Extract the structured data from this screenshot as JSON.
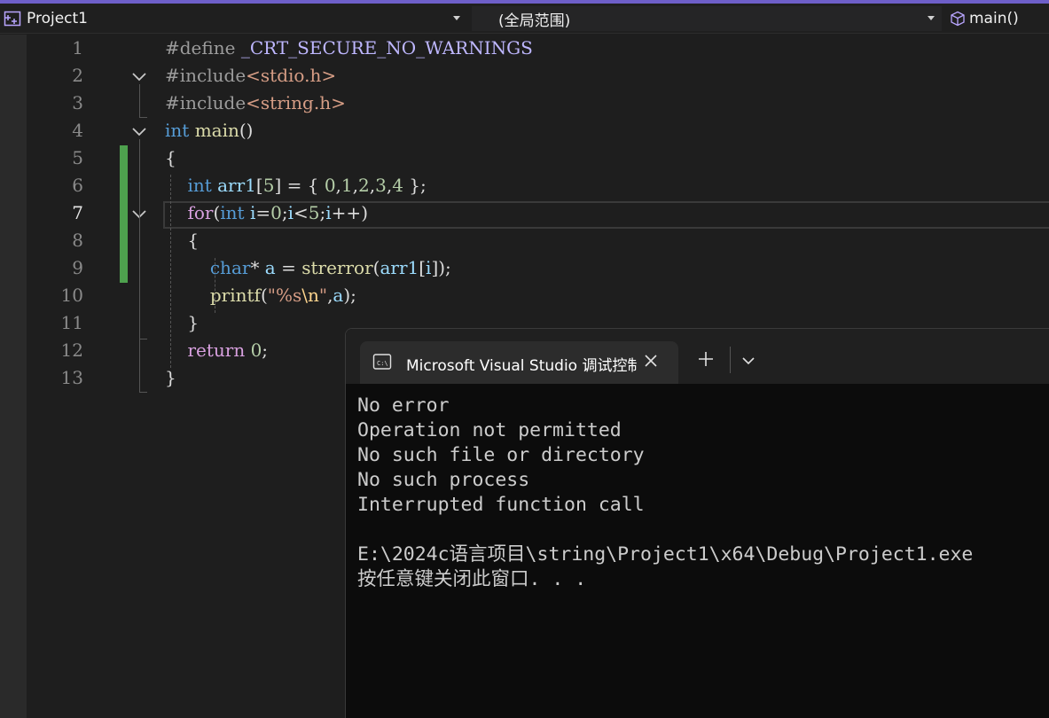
{
  "navbar": {
    "project": "Project1",
    "scope": "(全局范围)",
    "member": "main()"
  },
  "editor": {
    "current_line": 7,
    "lines": [
      {
        "n": "1",
        "tokens": [
          {
            "t": "#define ",
            "c": "pp"
          },
          {
            "t": "_CRT_SECURE_NO_WARNINGS",
            "c": "mac"
          }
        ]
      },
      {
        "n": "2",
        "tokens": [
          {
            "t": "#include",
            "c": "pp"
          },
          {
            "t": "<stdio.h>",
            "c": "inc"
          }
        ]
      },
      {
        "n": "3",
        "tokens": [
          {
            "t": "#include",
            "c": "pp"
          },
          {
            "t": "<string.h>",
            "c": "inc"
          }
        ]
      },
      {
        "n": "4",
        "tokens": [
          {
            "t": "int",
            "c": "k"
          },
          {
            "t": " ",
            "c": ""
          },
          {
            "t": "main",
            "c": "fn"
          },
          {
            "t": "()",
            "c": ""
          }
        ]
      },
      {
        "n": "5",
        "tokens": [
          {
            "t": "{",
            "c": ""
          }
        ]
      },
      {
        "n": "6",
        "tokens": [
          {
            "t": "    ",
            "c": ""
          },
          {
            "t": "int",
            "c": "k"
          },
          {
            "t": " ",
            "c": ""
          },
          {
            "t": "arr1",
            "c": "var"
          },
          {
            "t": "[",
            "c": ""
          },
          {
            "t": "5",
            "c": "num"
          },
          {
            "t": "] = { ",
            "c": ""
          },
          {
            "t": "0",
            "c": "num"
          },
          {
            "t": ",",
            "c": ""
          },
          {
            "t": "1",
            "c": "num"
          },
          {
            "t": ",",
            "c": ""
          },
          {
            "t": "2",
            "c": "num"
          },
          {
            "t": ",",
            "c": ""
          },
          {
            "t": "3",
            "c": "num"
          },
          {
            "t": ",",
            "c": ""
          },
          {
            "t": "4",
            "c": "num"
          },
          {
            "t": " };",
            "c": ""
          }
        ]
      },
      {
        "n": "7",
        "tokens": [
          {
            "t": "    ",
            "c": ""
          },
          {
            "t": "for",
            "c": "ctl"
          },
          {
            "t": "(",
            "c": ""
          },
          {
            "t": "int",
            "c": "k"
          },
          {
            "t": " ",
            "c": ""
          },
          {
            "t": "i",
            "c": "var"
          },
          {
            "t": "=",
            "c": ""
          },
          {
            "t": "0",
            "c": "num"
          },
          {
            "t": ";",
            "c": ""
          },
          {
            "t": "i",
            "c": "var"
          },
          {
            "t": "<",
            "c": ""
          },
          {
            "t": "5",
            "c": "num"
          },
          {
            "t": ";",
            "c": ""
          },
          {
            "t": "i",
            "c": "var"
          },
          {
            "t": "++)",
            "c": ""
          }
        ]
      },
      {
        "n": "8",
        "tokens": [
          {
            "t": "    {",
            "c": ""
          }
        ]
      },
      {
        "n": "9",
        "tokens": [
          {
            "t": "        ",
            "c": ""
          },
          {
            "t": "char",
            "c": "k"
          },
          {
            "t": "* ",
            "c": ""
          },
          {
            "t": "a",
            "c": "var"
          },
          {
            "t": " = ",
            "c": ""
          },
          {
            "t": "strerror",
            "c": "fn"
          },
          {
            "t": "(",
            "c": ""
          },
          {
            "t": "arr1",
            "c": "var"
          },
          {
            "t": "[",
            "c": ""
          },
          {
            "t": "i",
            "c": "var"
          },
          {
            "t": "]);",
            "c": ""
          }
        ]
      },
      {
        "n": "10",
        "tokens": [
          {
            "t": "        ",
            "c": ""
          },
          {
            "t": "printf",
            "c": "fn"
          },
          {
            "t": "(",
            "c": ""
          },
          {
            "t": "\"%s",
            "c": "str"
          },
          {
            "t": "\\n",
            "c": "esc"
          },
          {
            "t": "\"",
            "c": "str"
          },
          {
            "t": ",",
            "c": ""
          },
          {
            "t": "a",
            "c": "var"
          },
          {
            "t": ");",
            "c": ""
          }
        ]
      },
      {
        "n": "11",
        "tokens": [
          {
            "t": "    }",
            "c": ""
          }
        ]
      },
      {
        "n": "12",
        "tokens": [
          {
            "t": "    ",
            "c": ""
          },
          {
            "t": "return",
            "c": "ctl"
          },
          {
            "t": " ",
            "c": ""
          },
          {
            "t": "0",
            "c": "num"
          },
          {
            "t": ";",
            "c": ""
          }
        ]
      },
      {
        "n": "13",
        "tokens": [
          {
            "t": "}",
            "c": ""
          }
        ]
      }
    ]
  },
  "console": {
    "tab_title": "Microsoft Visual Studio 调试控制台",
    "output": [
      "No error",
      "Operation not permitted",
      "No such file or directory",
      "No such process",
      "Interrupted function call",
      "",
      "E:\\2024c语言项目\\string\\Project1\\x64\\Debug\\Project1.exe",
      "按任意键关闭此窗口. . ."
    ]
  },
  "colors": {
    "accent": "#6e5fc9",
    "change_marker": "#4ea14e",
    "keyword": "#569cd6",
    "function": "#dcdcaa",
    "variable": "#9cdcfe",
    "number": "#b5cea8",
    "control": "#d8a0df",
    "string": "#d69d85"
  },
  "icons": [
    "project-icon",
    "dropdown-arrow-icon",
    "cube-icon",
    "fold-chevron-icon",
    "console-icon",
    "close-icon",
    "plus-icon",
    "chevron-down-icon"
  ]
}
